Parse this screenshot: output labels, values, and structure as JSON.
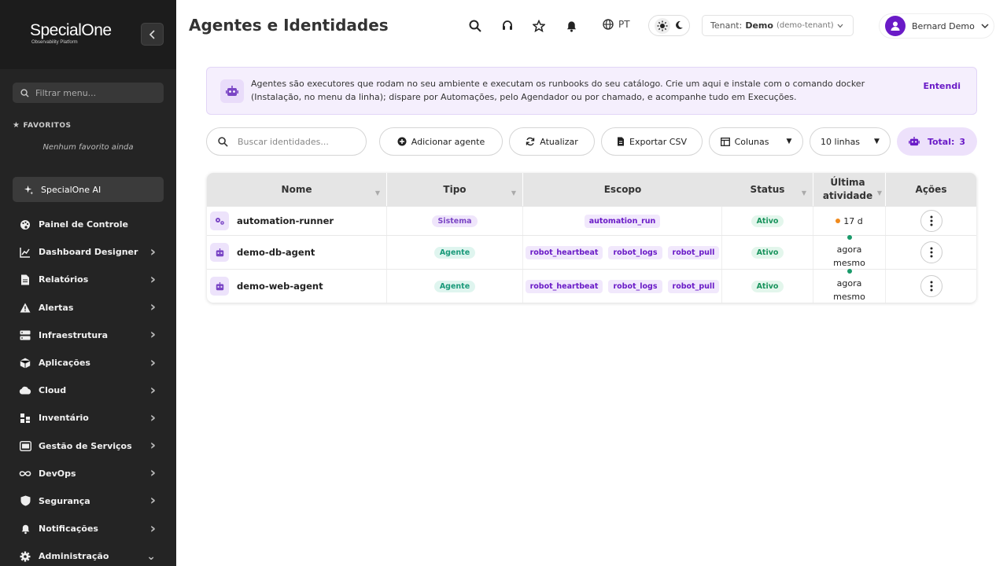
{
  "sidebar": {
    "logo": {
      "main": "SpecialOne",
      "sub": "Observability Platform"
    },
    "search_placeholder": "Filtrar menu...",
    "favorites_title": "FAVORITOS",
    "favorites_empty": "Nenhum favorito ainda",
    "ai_label": "SpecialOne AI",
    "items": [
      {
        "label": "Painel de Controle",
        "icon": "palette-icon",
        "chevron": ""
      },
      {
        "label": "Dashboard Designer",
        "icon": "chart-line-icon",
        "chevron": "›"
      },
      {
        "label": "Relatórios",
        "icon": "document-icon",
        "chevron": "›"
      },
      {
        "label": "Alertas",
        "icon": "warning-icon",
        "chevron": "›"
      },
      {
        "label": "Infraestrutura",
        "icon": "server-icon",
        "chevron": "›"
      },
      {
        "label": "Aplicações",
        "icon": "box-icon",
        "chevron": "›"
      },
      {
        "label": "Cloud",
        "icon": "cloud-icon",
        "chevron": "›"
      },
      {
        "label": "Inventário",
        "icon": "inventory-icon",
        "chevron": "›"
      },
      {
        "label": "Gestão de Serviços",
        "icon": "service-icon",
        "chevron": "›"
      },
      {
        "label": "DevOps",
        "icon": "infinity-icon",
        "chevron": "›"
      },
      {
        "label": "Segurança",
        "icon": "shield-icon",
        "chevron": "›"
      },
      {
        "label": "Notificações",
        "icon": "bell-icon",
        "chevron": "›"
      },
      {
        "label": "Administração",
        "icon": "gear-icon",
        "chevron": "⌄"
      }
    ]
  },
  "header": {
    "title": "Agentes e Identidades",
    "language": "PT",
    "tenant_label": "Tenant:",
    "tenant_value": "Demo",
    "tenant_slug": "(demo-tenant)",
    "user_name": "Bernard Demo"
  },
  "banner": {
    "text": "Agentes são executores que rodam no seu ambiente e executam os runbooks do seu catálogo. Crie um aqui e instale com o comando docker (Instalação, no menu da linha); dispare por Automações, pelo Agendador ou por chamado, e acompanhe tudo em Execuções.",
    "dismiss": "Entendi"
  },
  "toolbar": {
    "search_placeholder": "Buscar identidades...",
    "add_agent": "Adicionar agente",
    "refresh": "Atualizar",
    "export_csv": "Exportar CSV",
    "columns": "Colunas",
    "rows": "10 linhas",
    "total_label": "Total:",
    "total_value": "3"
  },
  "table": {
    "headers": {
      "name": "Nome",
      "type": "Tipo",
      "scope": "Escopo",
      "status": "Status",
      "last_activity": "Última atividade",
      "actions": "Ações"
    },
    "rows": [
      {
        "name": "automation-runner",
        "type": "Sistema",
        "scopes": [
          "automation_run"
        ],
        "status": "Ativo",
        "activity": "17 d",
        "activity_color": "#f08a1c"
      },
      {
        "name": "demo-db-agent",
        "type": "Agente",
        "scopes": [
          "robot_heartbeat",
          "robot_logs",
          "robot_pull"
        ],
        "status": "Ativo",
        "activity": "agora mesmo",
        "activity_color": "#1a9a6a"
      },
      {
        "name": "demo-web-agent",
        "type": "Agente",
        "scopes": [
          "robot_heartbeat",
          "robot_logs",
          "robot_pull"
        ],
        "status": "Ativo",
        "activity": "agora mesmo",
        "activity_color": "#1a9a6a"
      }
    ]
  },
  "colors": {
    "accent": "#6a1bc7",
    "sidebar": "#242424",
    "active_green": "#18935c"
  }
}
